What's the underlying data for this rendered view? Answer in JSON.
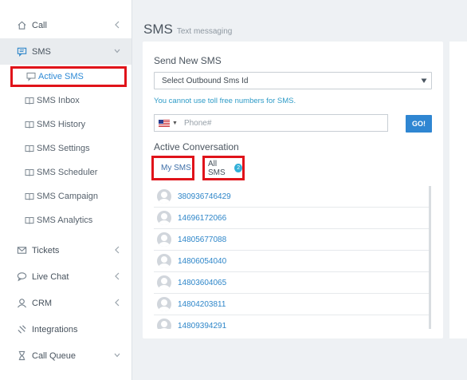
{
  "sidebar": {
    "items_top": [
      {
        "label": "Call",
        "icon": "home-icon"
      },
      {
        "label": "SMS",
        "icon": "sms-icon"
      }
    ],
    "sms_sub": [
      {
        "label": "Active SMS",
        "icon": "chat-icon"
      },
      {
        "label": "SMS Inbox",
        "icon": "book-icon"
      },
      {
        "label": "SMS History",
        "icon": "book-icon"
      },
      {
        "label": "SMS Settings",
        "icon": "book-icon"
      },
      {
        "label": "SMS Scheduler",
        "icon": "book-icon"
      },
      {
        "label": "SMS Campaign",
        "icon": "book-icon"
      },
      {
        "label": "SMS Analytics",
        "icon": "book-icon"
      }
    ],
    "items_bottom": [
      {
        "label": "Tickets",
        "icon": "mail-icon"
      },
      {
        "label": "Live Chat",
        "icon": "chat-bubble-icon"
      },
      {
        "label": "CRM",
        "icon": "user-icon"
      },
      {
        "label": "Integrations",
        "icon": "plug-icon"
      },
      {
        "label": "Call Queue",
        "icon": "hourglass-icon"
      }
    ]
  },
  "header": {
    "title": "SMS",
    "subtitle": "Text messaging"
  },
  "send": {
    "title": "Send New SMS",
    "select_value": "Select Outbound Sms Id",
    "warning": "You cannot use toll free numbers for SMS.",
    "phone_placeholder": "Phone#",
    "go_label": "GO!"
  },
  "conversations": {
    "title": "Active Conversation",
    "tab_my": "My SMS",
    "tab_all": "All SMS",
    "all_count": "2",
    "numbers": [
      "380936746429",
      "14696172066",
      "14805677088",
      "14806054040",
      "14803604065",
      "14804203811",
      "14809394291"
    ]
  },
  "colors": {
    "accent": "#2f86d2",
    "highlight": "#e0131a",
    "badge": "#32b0d8"
  }
}
